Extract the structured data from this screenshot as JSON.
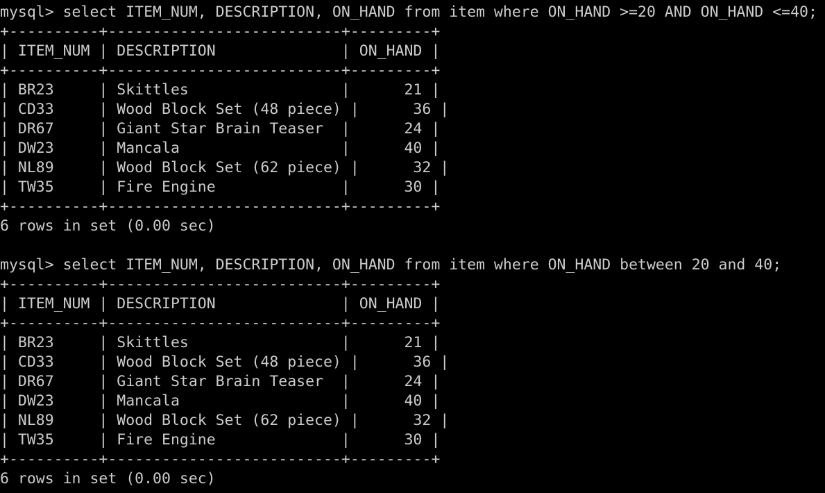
{
  "terminal": {
    "blocks": [
      {
        "prompt": "mysql> ",
        "command": "select ITEM_NUM, DESCRIPTION, ON_HAND from item where ON_HAND >=20 AND ON_HAND <=40;",
        "border": "+----------+--------------------------+---------+",
        "header": "| ITEM_NUM | DESCRIPTION              | ON_HAND |",
        "rows": [
          "| BR23     | Skittles                 |      21 |",
          "| CD33     | Wood Block Set (48 piece) |      36 |",
          "| DR67     | Giant Star Brain Teaser  |      24 |",
          "| DW23     | Mancala                  |      40 |",
          "| NL89     | Wood Block Set (62 piece) |      32 |",
          "| TW35     | Fire Engine              |      30 |"
        ],
        "summary": "6 rows in set (0.00 sec)"
      },
      {
        "prompt": "mysql> ",
        "command": "select ITEM_NUM, DESCRIPTION, ON_HAND from item where ON_HAND between 20 and 40;",
        "border": "+----------+--------------------------+---------+",
        "header": "| ITEM_NUM | DESCRIPTION              | ON_HAND |",
        "rows": [
          "| BR23     | Skittles                 |      21 |",
          "| CD33     | Wood Block Set (48 piece) |      36 |",
          "| DR67     | Giant Star Brain Teaser  |      24 |",
          "| DW23     | Mancala                  |      40 |",
          "| NL89     | Wood Block Set (62 piece) |      32 |",
          "| TW35     | Fire Engine              |      30 |"
        ],
        "summary": "6 rows in set (0.00 sec)"
      }
    ]
  }
}
